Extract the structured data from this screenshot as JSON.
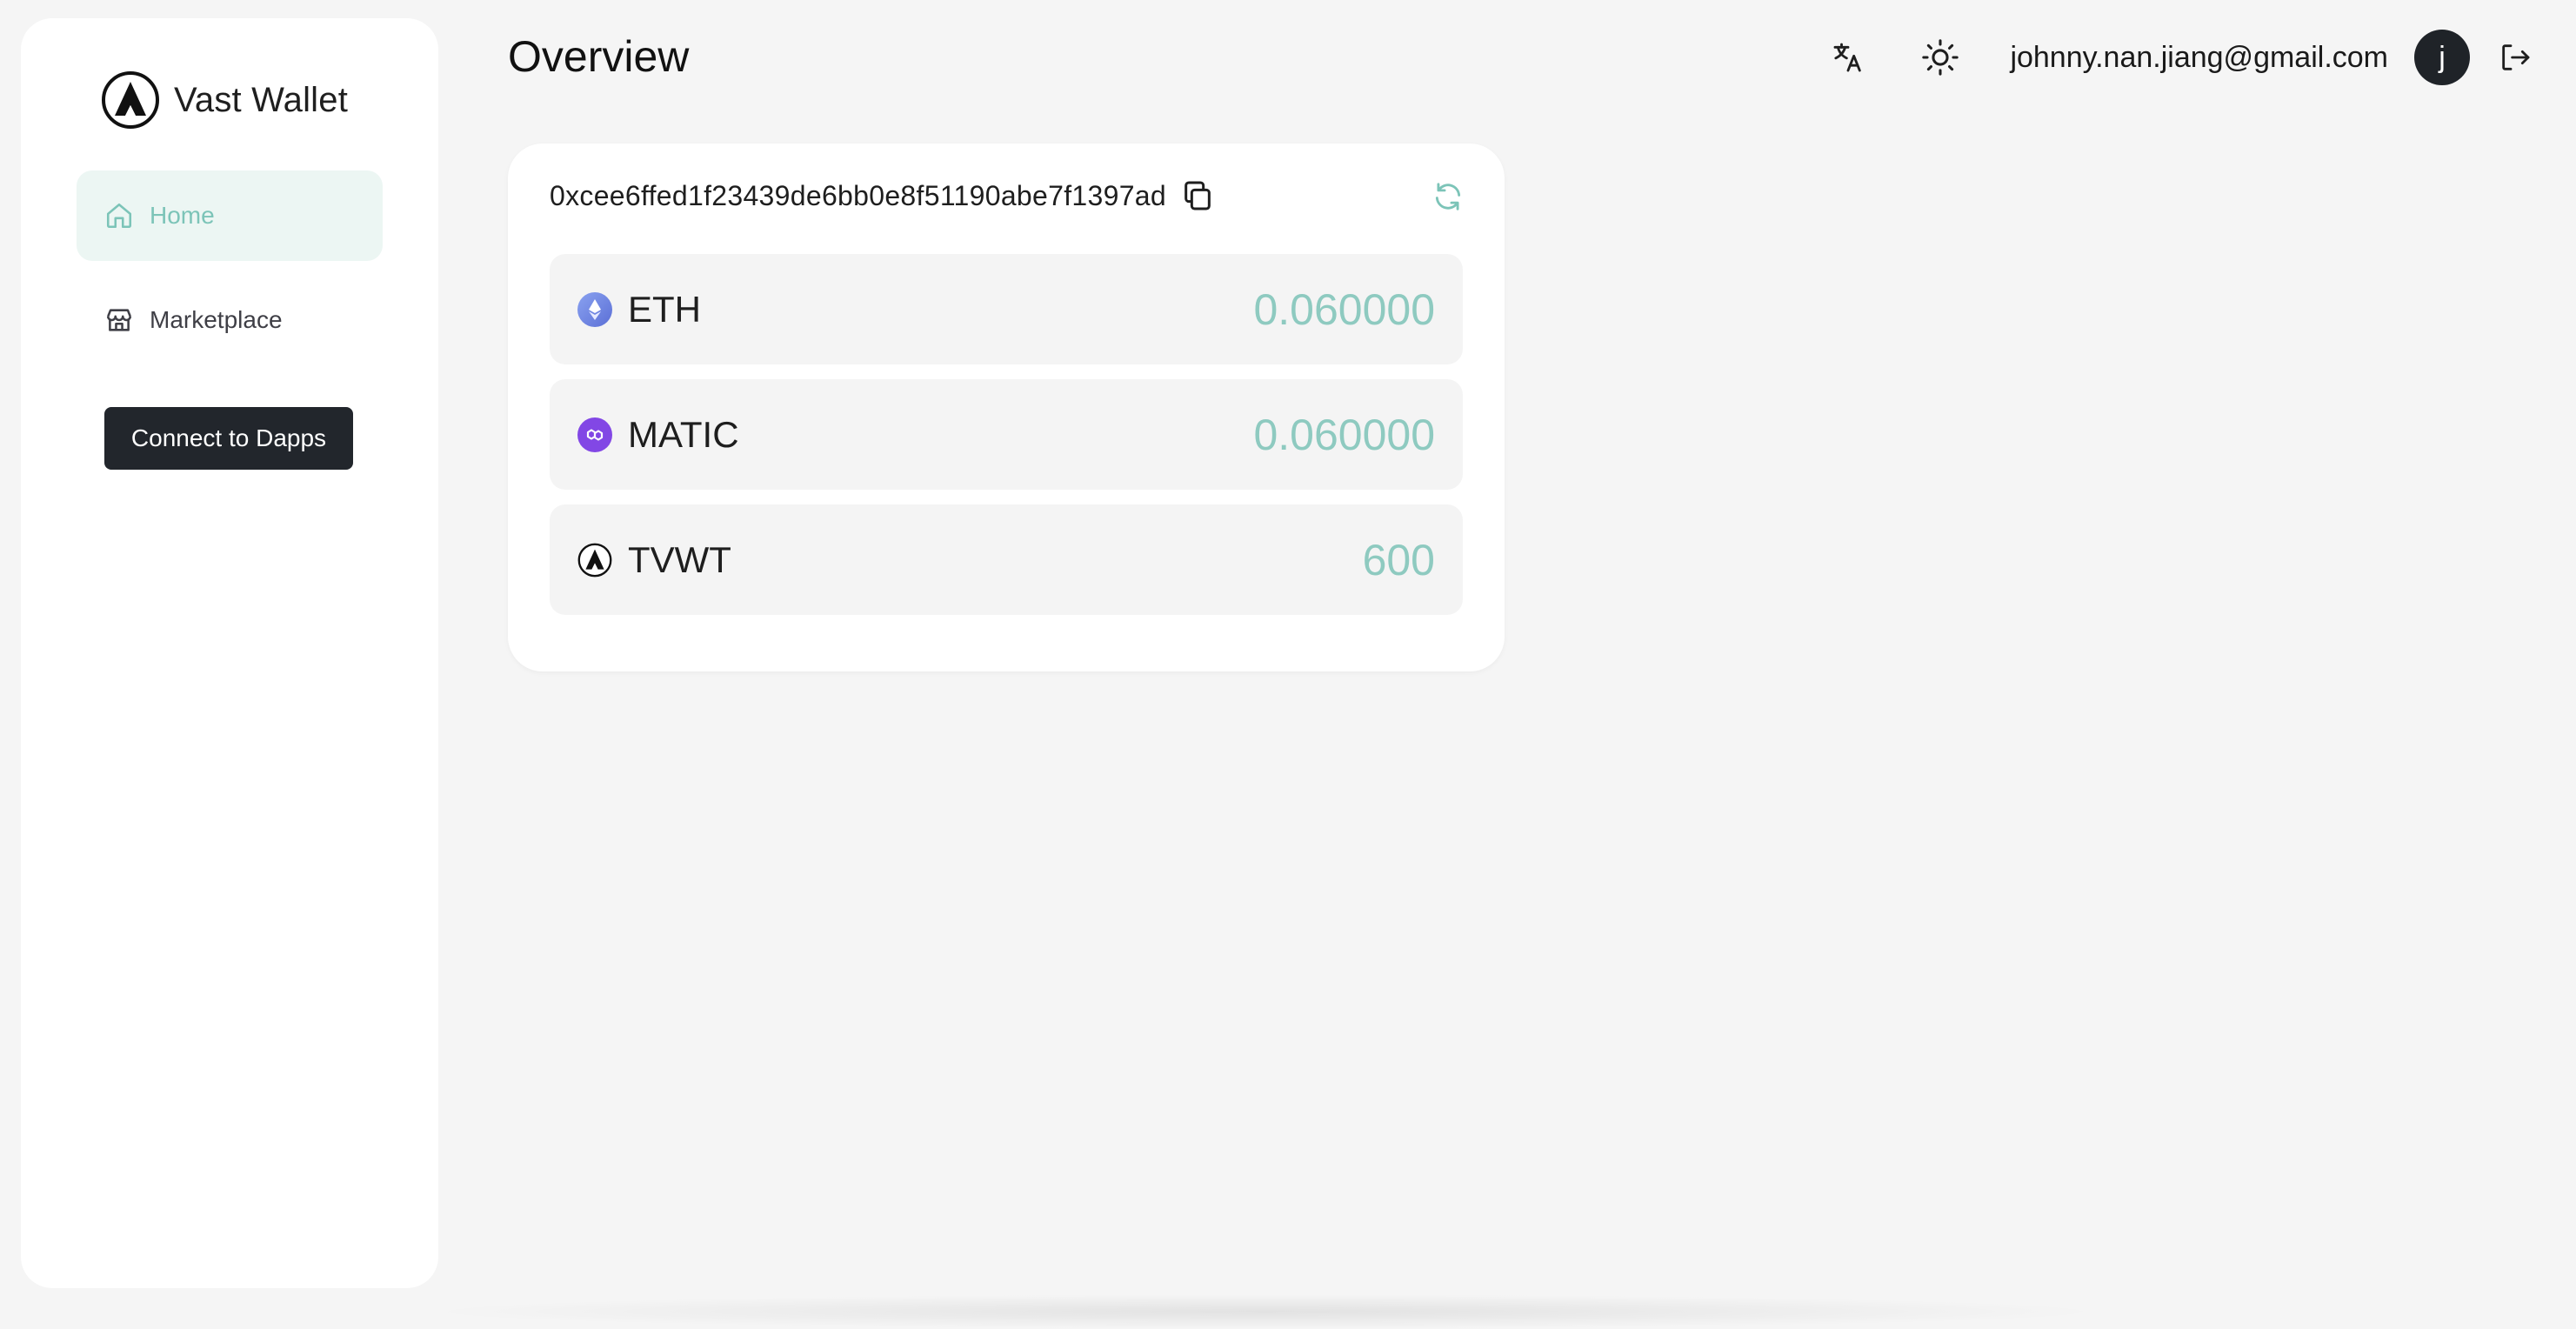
{
  "brand": {
    "name": "Vast Wallet",
    "logo_icon": "vast-wallet-logo-icon"
  },
  "sidebar": {
    "items": [
      {
        "label": "Home",
        "icon": "home-icon",
        "active": true
      },
      {
        "label": "Marketplace",
        "icon": "store-icon",
        "active": false
      }
    ],
    "connect_button": "Connect to Dapps"
  },
  "header": {
    "title": "Overview",
    "translate_icon": "translate-icon",
    "theme_icon": "sun-icon",
    "user_email": "johnny.nan.jiang@gmail.com",
    "avatar_initial": "j",
    "logout_icon": "logout-icon"
  },
  "wallet": {
    "address": "0xcee6ffed1f23439de6bb0e8f51190abe7f1397ad",
    "tokens": [
      {
        "symbol": "ETH",
        "balance": "0.060000",
        "icon": "eth-icon"
      },
      {
        "symbol": "MATIC",
        "balance": "0.060000",
        "icon": "matic-icon"
      },
      {
        "symbol": "TVWT",
        "balance": "600",
        "icon": "tvwt-icon"
      }
    ]
  },
  "colors": {
    "accent": "#7cc4b8",
    "balance": "#8ecac0",
    "active_nav_bg": "#ecf6f3",
    "dark_button": "#22262c",
    "background": "#f5f5f5"
  }
}
